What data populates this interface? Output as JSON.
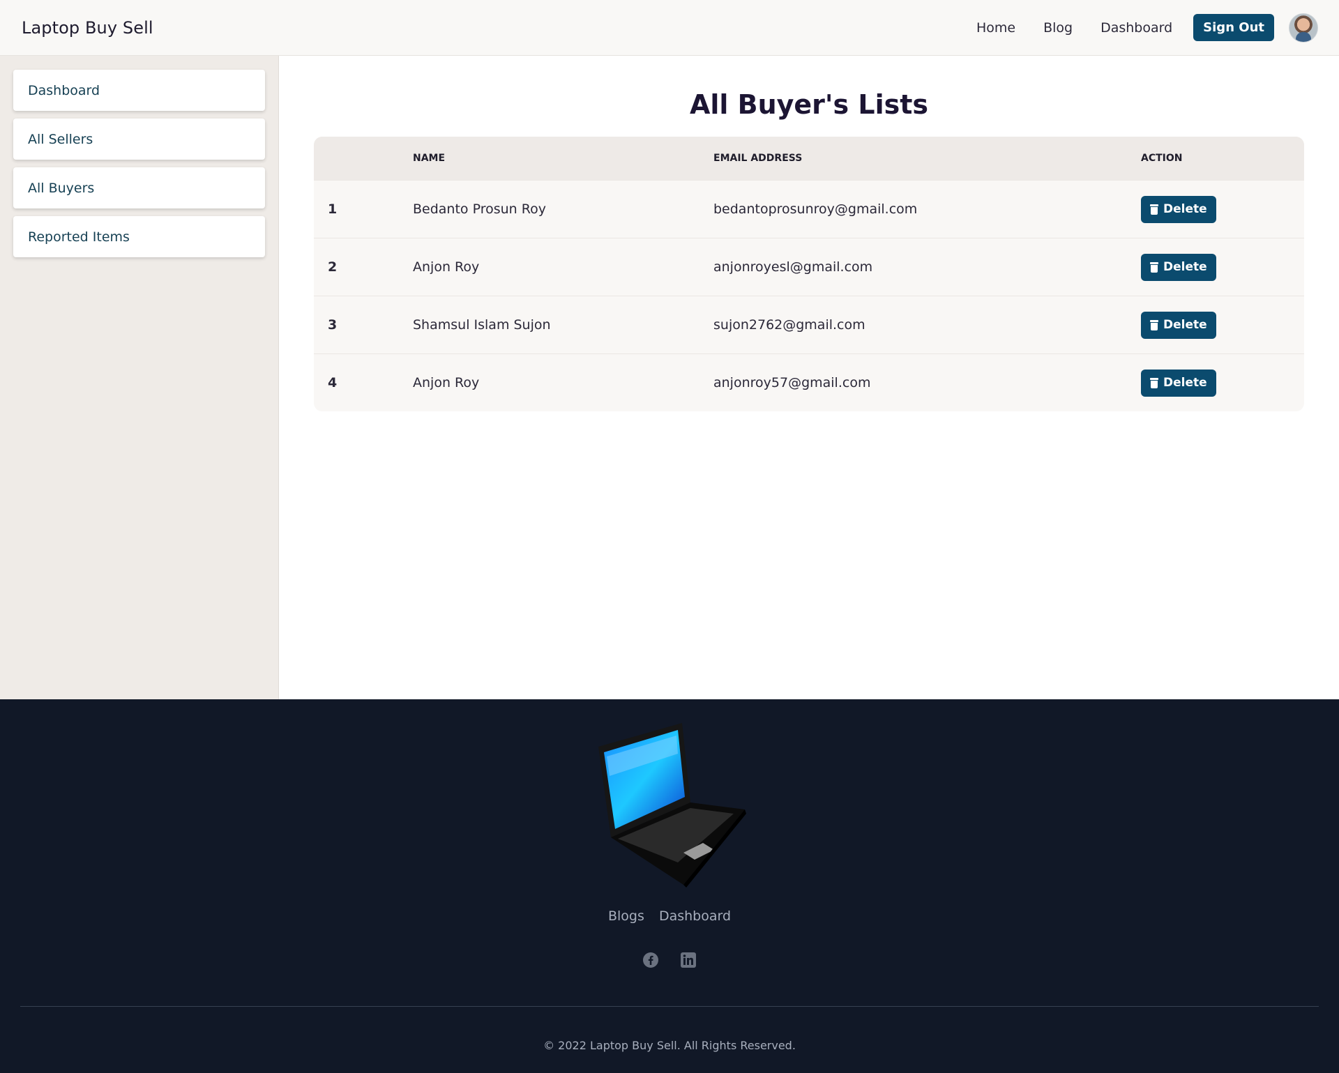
{
  "header": {
    "brand": "Laptop Buy Sell",
    "nav": [
      "Home",
      "Blog",
      "Dashboard"
    ],
    "signout_label": "Sign Out"
  },
  "sidebar": {
    "items": [
      {
        "label": "Dashboard"
      },
      {
        "label": "All Sellers"
      },
      {
        "label": "All Buyers"
      },
      {
        "label": "Reported Items"
      }
    ]
  },
  "main": {
    "title": "All Buyer's Lists",
    "columns": [
      "",
      "NAME",
      "EMAIL ADDRESS",
      "ACTION"
    ],
    "rows": [
      {
        "idx": "1",
        "name": "Bedanto Prosun Roy",
        "email": "bedantoprosunroy@gmail.com",
        "action": "Delete"
      },
      {
        "idx": "2",
        "name": "Anjon Roy",
        "email": "anjonroyesl@gmail.com",
        "action": "Delete"
      },
      {
        "idx": "3",
        "name": "Shamsul Islam Sujon",
        "email": "sujon2762@gmail.com",
        "action": "Delete"
      },
      {
        "idx": "4",
        "name": "Anjon Roy",
        "email": "anjonroy57@gmail.com",
        "action": "Delete"
      }
    ]
  },
  "footer": {
    "links": [
      "Blogs",
      "Dashboard"
    ],
    "socials": [
      "facebook-icon",
      "linkedin-icon"
    ],
    "copyright": "© 2022 Laptop Buy Sell. All Rights Reserved."
  },
  "colors": {
    "primary": "#0b4b6e",
    "footer_bg": "#111827",
    "sidebar_bg": "#efebe7"
  }
}
